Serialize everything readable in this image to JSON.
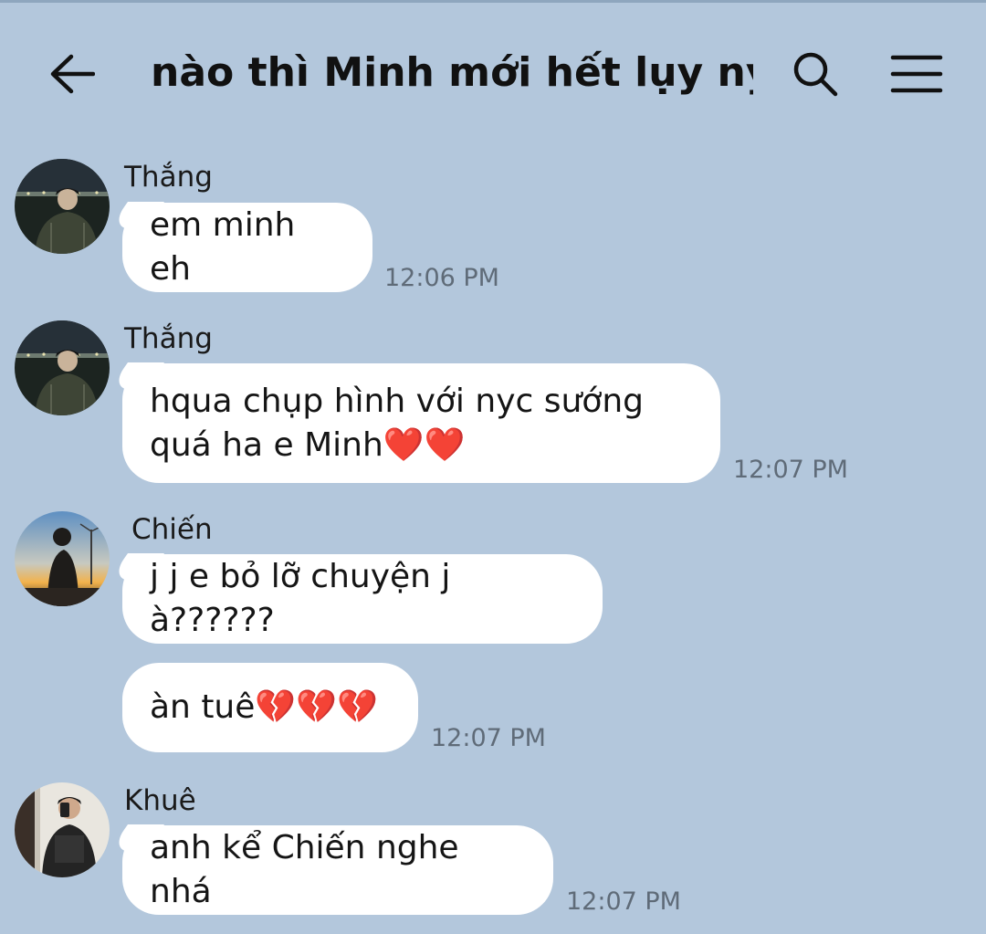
{
  "header": {
    "title": "nào thì Minh mới hết lụy ny...",
    "back_icon": "arrow-left-icon",
    "search_icon": "search-icon",
    "menu_icon": "hamburger-menu-icon"
  },
  "colors": {
    "background": "#b3c7dc",
    "bubble": "#ffffff",
    "timestamp": "#5f6b78"
  },
  "messages": [
    {
      "sender": "Thắng",
      "text": "em minh eh",
      "time": "12:06 PM"
    },
    {
      "sender": "Thắng",
      "text": "hqua chụp hình với nyc sướng\nquá ha e Minh❤️❤️",
      "time": "12:07 PM"
    },
    {
      "sender": "Chiến",
      "text": "j j e bỏ lỡ chuyện j à??????",
      "time": ""
    },
    {
      "sender": "",
      "text": "àn tuê💔💔💔",
      "time": "12:07 PM"
    },
    {
      "sender": "Khuê",
      "text": "anh kể Chiến nghe nhá",
      "time": "12:07 PM"
    }
  ]
}
